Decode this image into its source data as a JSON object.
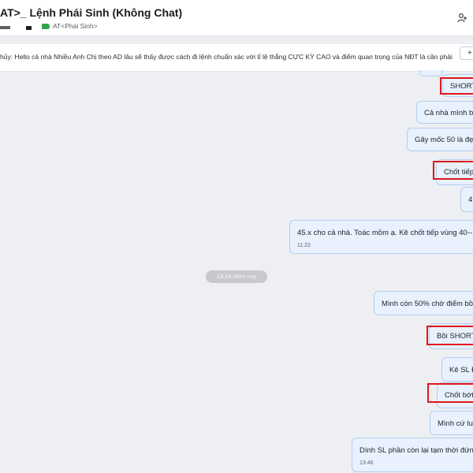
{
  "header": {
    "title": "AT>_ Lệnh Phái Sinh (Không Chat)",
    "tag_label": "AT<Phái Sinh>"
  },
  "pinned": {
    "text": "hủy: Hello cả nhà Nhiều Anh Chị theo AD lâu sẽ thấy được cách đi lệnh chuẩn xác với tỉ lệ thắng CỰC KỲ CAO và điểm quan trọng của NĐT là cần phải ...",
    "button_label": "+"
  },
  "messages": [
    {
      "text": "SHORT",
      "highlighted": true
    },
    {
      "text": "Cả nhà mình b"
    },
    {
      "text": "Gãy mốc 50 là đẹ"
    },
    {
      "text": "Chốt tiếp",
      "highlighted": true
    },
    {
      "text": "47"
    },
    {
      "text": "45.x cho cả nhà. Toác mồm ạ. Kê chốt tiếp vùng 40--",
      "time": "11:22"
    },
    {
      "text": "Mình còn 50% chờ điểm bồ"
    },
    {
      "text": "Bồi SHORT",
      "highlighted": true
    },
    {
      "text": "Kê SL Đ"
    },
    {
      "text": "Chốt bớt",
      "highlighted": true
    },
    {
      "text": "Mình cứ lu"
    },
    {
      "text": "Dính SL phần còn lại tạm thời đứn",
      "time": "13:46"
    }
  ],
  "date_divider": "13:19 Hôm nay",
  "colors": {
    "bubble_bg": "#e8f1fd",
    "bubble_border": "#b3cdf1",
    "highlight": "#e0171c",
    "tag": "#2ea44f"
  }
}
